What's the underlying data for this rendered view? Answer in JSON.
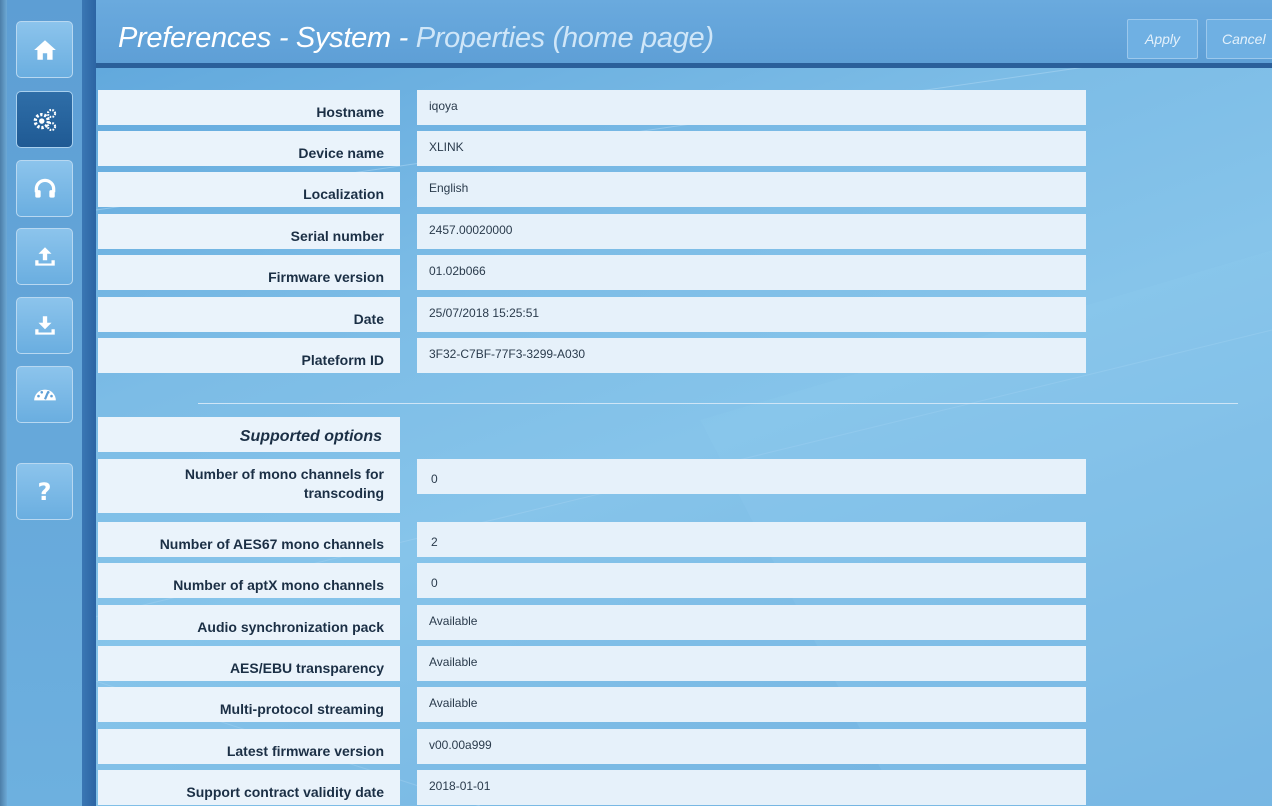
{
  "header": {
    "title_main": "Preferences - System - ",
    "title_sub": "Properties (home page)",
    "apply_label": "Apply",
    "cancel_label": "Cancel"
  },
  "sidebar": {
    "items": [
      {
        "icon": "home-icon",
        "active": false
      },
      {
        "icon": "gears-icon",
        "active": true
      },
      {
        "icon": "headphones-icon",
        "active": false
      },
      {
        "icon": "upload-icon",
        "active": false
      },
      {
        "icon": "download-icon",
        "active": false
      },
      {
        "icon": "gauge-icon",
        "active": false
      },
      {
        "icon": "help-icon",
        "active": false,
        "label": "?"
      }
    ]
  },
  "properties": [
    {
      "label": "Hostname",
      "value": "iqoya"
    },
    {
      "label": "Device name",
      "value": "XLINK"
    },
    {
      "label": "Localization",
      "value": "English"
    },
    {
      "label": "Serial number",
      "value": "2457.00020000"
    },
    {
      "label": "Firmware version",
      "value": "01.02b066"
    },
    {
      "label": "Date",
      "value": "25/07/2018 15:25:51"
    },
    {
      "label": "Plateform ID",
      "value": "3F32-C7BF-77F3-3299-A030"
    }
  ],
  "options": {
    "heading": "Supported options",
    "items": [
      {
        "label_line1": "Number of mono channels for",
        "label_line2": "transcoding",
        "value": "0"
      },
      {
        "label": "Number of AES67 mono channels",
        "value": "2"
      },
      {
        "label": "Number of aptX mono channels",
        "value": "0"
      },
      {
        "label": "Audio synchronization pack",
        "value": "Available"
      },
      {
        "label": "AES/EBU transparency",
        "value": "Available"
      },
      {
        "label": "Multi-protocol streaming",
        "value": "Available"
      },
      {
        "label": "Latest firmware version",
        "value": "v00.00a999"
      },
      {
        "label": "Support contract validity date",
        "value": "2018-01-01"
      }
    ]
  },
  "colors": {
    "background": "#7cbce6",
    "header_border": "#2a5f9a",
    "active_nav": "#1f5a94",
    "field_background": "#e6f1fa"
  }
}
